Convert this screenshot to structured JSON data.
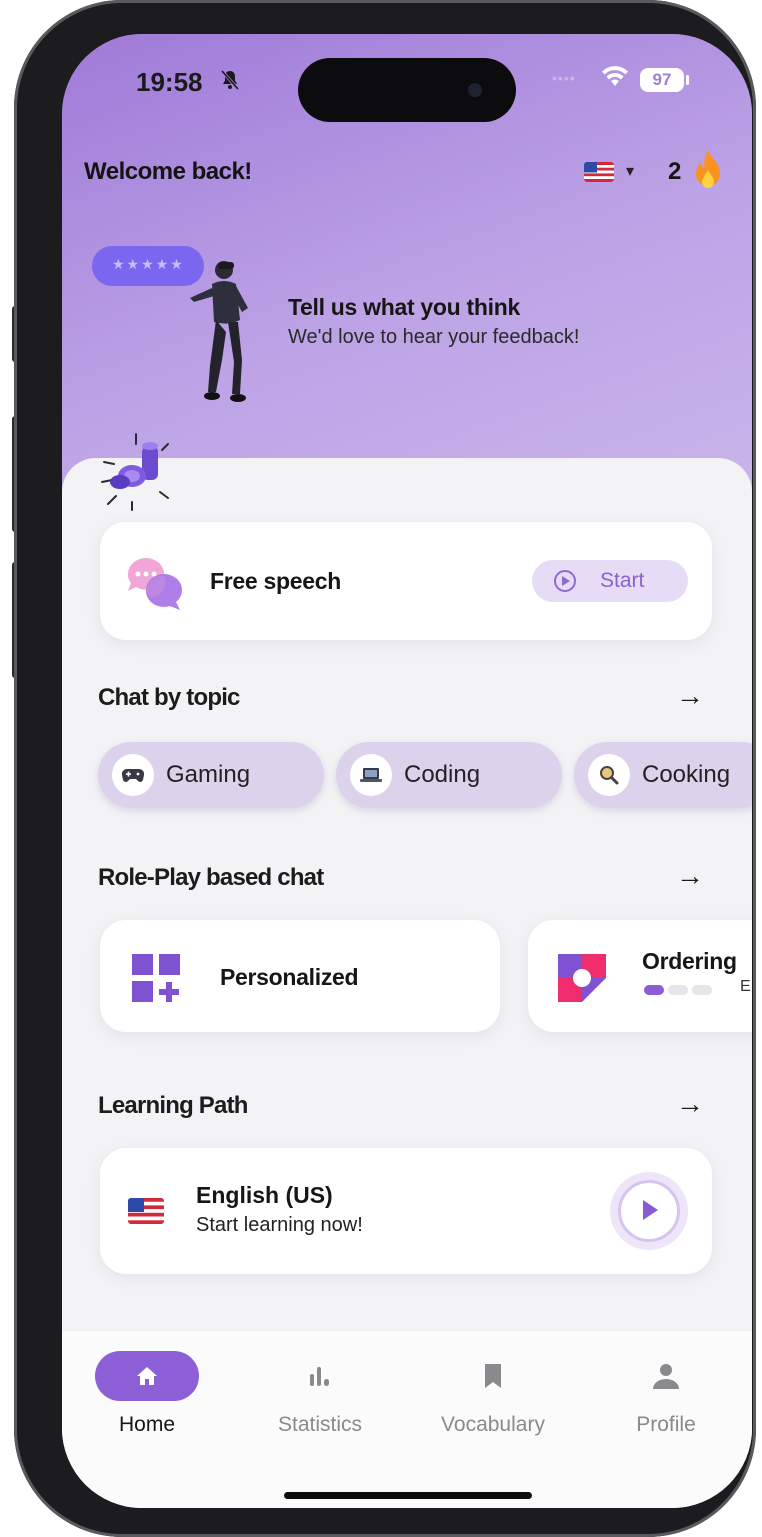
{
  "status_bar": {
    "time": "19:58",
    "battery": "97"
  },
  "header": {
    "welcome": "Welcome back!",
    "streak": "2"
  },
  "feedback": {
    "title": "Tell us what you think",
    "subtitle": "We'd love to hear your feedback!"
  },
  "free_speech": {
    "label": "Free speech",
    "start_label": "Start"
  },
  "chat_by_topic": {
    "title": "Chat by topic",
    "topics": [
      {
        "label": "Gaming",
        "icon": "game-controller-icon"
      },
      {
        "label": "Coding",
        "icon": "laptop-icon"
      },
      {
        "label": "Cooking",
        "icon": "magnifier-icon"
      }
    ]
  },
  "role_play": {
    "title": "Role-Play based chat",
    "cards": [
      {
        "label": "Personalized",
        "icon": "grid-plus-icon"
      },
      {
        "label": "Ordering",
        "icon": "pinwheel-icon",
        "level_text": "E",
        "level_filled": 1,
        "level_total": 3
      }
    ]
  },
  "learning_path": {
    "title": "Learning Path",
    "course_title": "English (US)",
    "course_subtitle": "Start learning now!"
  },
  "tabs": [
    {
      "label": "Home",
      "icon": "home-icon",
      "active": true
    },
    {
      "label": "Statistics",
      "icon": "bar-chart-icon",
      "active": false
    },
    {
      "label": "Vocabulary",
      "icon": "bookmark-icon",
      "active": false
    },
    {
      "label": "Profile",
      "icon": "person-icon",
      "active": false
    }
  ],
  "colors": {
    "accent": "#8d5fd6",
    "header_gradient_top": "#9f7ad8",
    "chip_bg": "#dcd2ec"
  }
}
